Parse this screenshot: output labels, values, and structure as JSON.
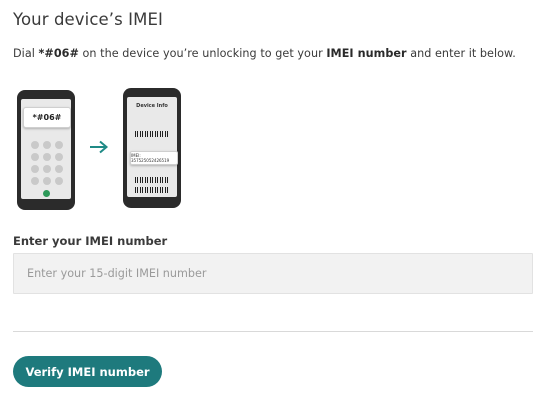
{
  "page": {
    "title": "Your device’s IMEI",
    "instructions": {
      "prefix": "Dial ",
      "code": "*#06#",
      "middle": " on the device you’re unlocking to get your ",
      "highlight": "IMEI number",
      "suffix": " and enter it below."
    }
  },
  "illustration": {
    "dial_code": "*#06#",
    "device_info_title": "Device Info",
    "imei_sample": "IMEI: 357525052426519",
    "arrow_icon": "arrow-right-icon",
    "accent_color": "#1f8a86"
  },
  "form": {
    "imei_label": "Enter your IMEI number",
    "imei_placeholder": "Enter your 15-digit IMEI number",
    "imei_value": ""
  },
  "actions": {
    "verify_label": "Verify IMEI number",
    "button_color": "#1e7a7d"
  }
}
